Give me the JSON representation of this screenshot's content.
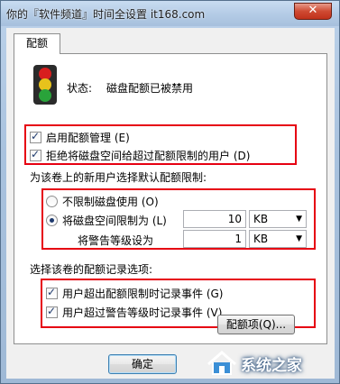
{
  "window": {
    "title": "你的『软件频道』时间全设置 it168.com",
    "close_glyph": "✕"
  },
  "tab": {
    "label": "配额"
  },
  "status": {
    "label": "状态:",
    "value": "磁盘配额已被禁用"
  },
  "options": {
    "enable_quota": {
      "label": "启用配额管理 (E)",
      "checked": true
    },
    "deny_space": {
      "label": "拒绝将磁盘空间给超过配额限制的用户 (D)",
      "checked": true
    }
  },
  "default_limit": {
    "heading": "为该卷上的新用户选择默认配额限制:",
    "no_limit": {
      "label": "不限制磁盘使用 (O)",
      "selected": false
    },
    "limit_to": {
      "label": "将磁盘空间限制为 (L)",
      "selected": true,
      "value": "10",
      "unit": "KB"
    },
    "warning": {
      "label": "将警告等级设为",
      "value": "1",
      "unit": "KB"
    }
  },
  "logging": {
    "heading": "选择该卷的配额记录选项:",
    "log_limit": {
      "label": "用户超出配额限制时记录事件 (G)",
      "checked": true
    },
    "log_warning": {
      "label": "用户超过警告等级时记录事件 (V)",
      "checked": true
    }
  },
  "buttons": {
    "quota_entries": "配额项(Q)...",
    "ok": "确定"
  },
  "watermark": {
    "text": "系统之家"
  },
  "colors": {
    "highlight_box": "#e60012",
    "traffic_red": "#d81e1e",
    "traffic_yellow": "#e7c21c",
    "traffic_green": "#29a33a"
  },
  "icons": {
    "status": "traffic-light-icon",
    "close": "close-icon",
    "dropdown": "chevron-down-icon",
    "watermark": "house-logo-icon"
  }
}
